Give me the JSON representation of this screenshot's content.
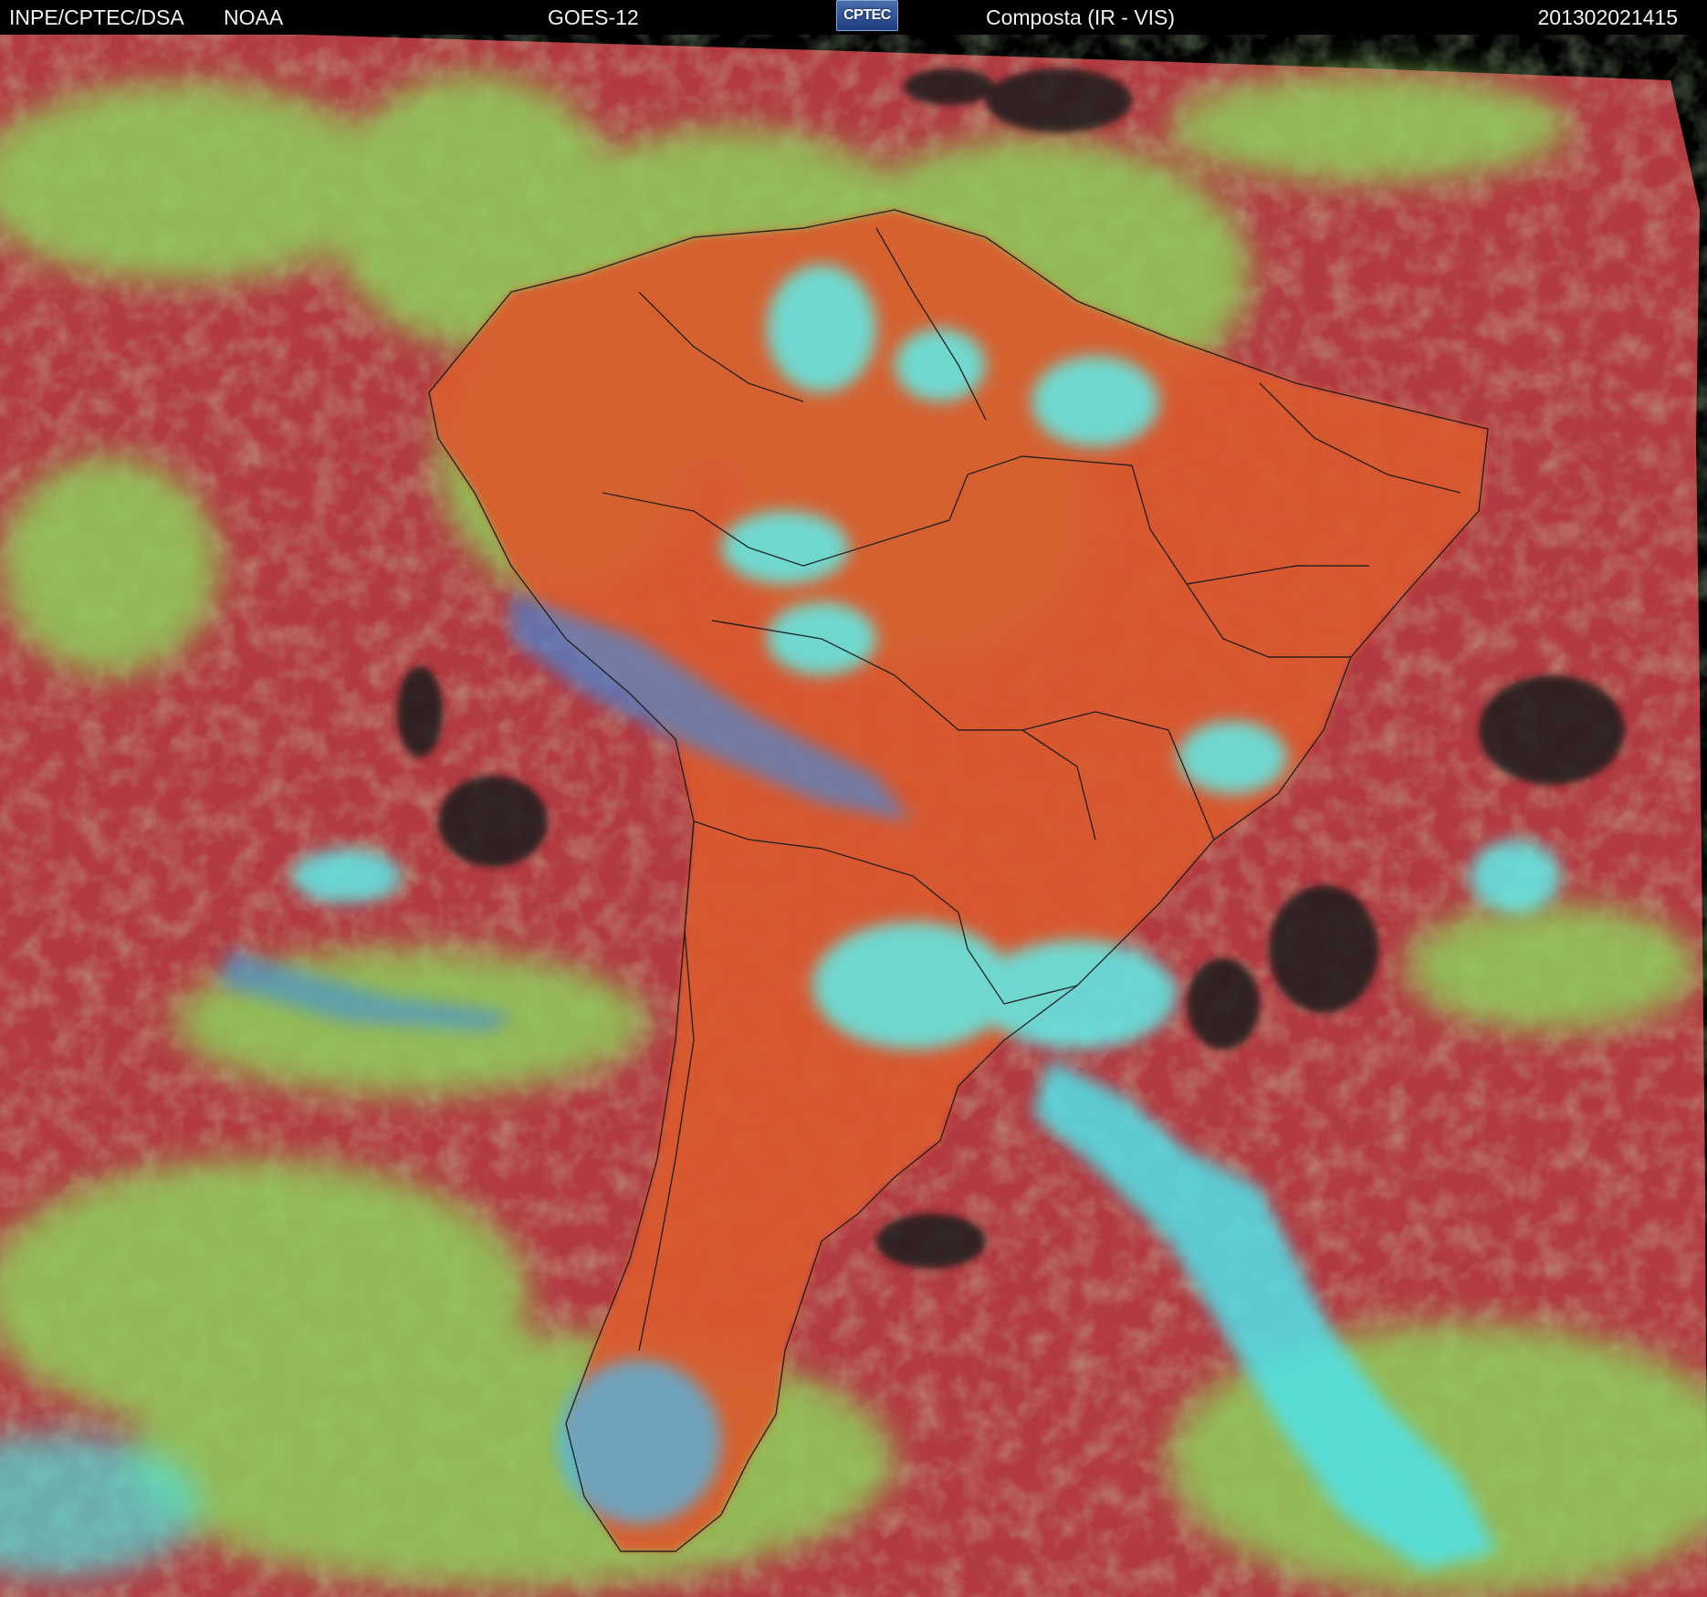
{
  "header": {
    "organization": "INPE/CPTEC/DSA",
    "agency": "NOAA",
    "satellite": "GOES-12",
    "logo_text": "CPTEC",
    "product": "Composta (IR - VIS)",
    "timestamp": "201302021415"
  },
  "colors": {
    "ocean_clear": "#b5373f",
    "land_clear": "#e0562a",
    "low_cloud": "#9ad65a",
    "high_cloud": "#5ff2ee",
    "thin_cloud": "#3f8fe0",
    "dark_gaps": "#1b1b1b",
    "borders": "#1a1a1a",
    "background": "#000000"
  }
}
